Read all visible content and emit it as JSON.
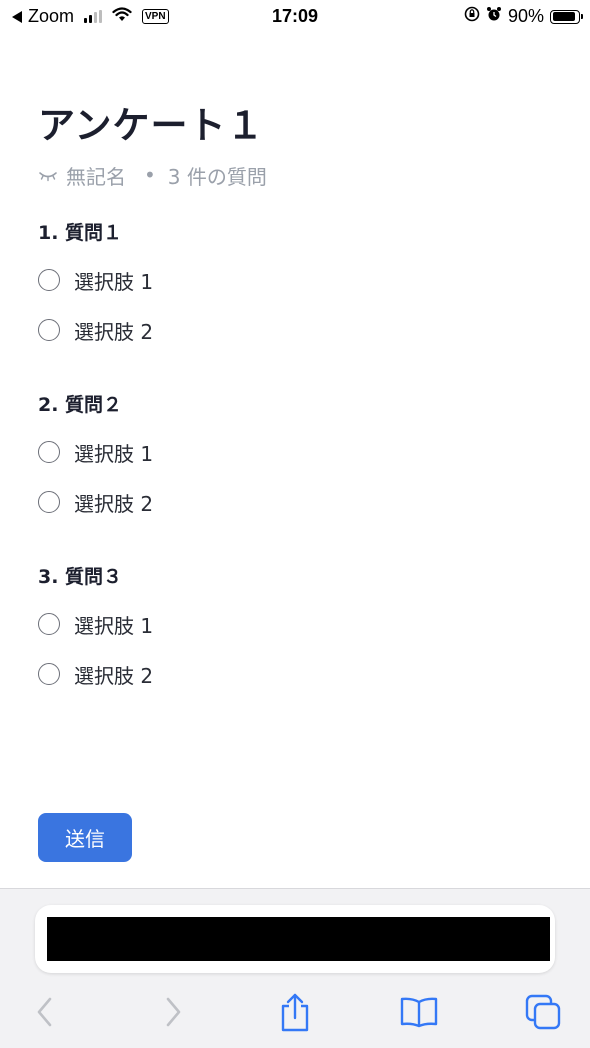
{
  "status_bar": {
    "back_app": "Zoom",
    "vpn": "VPN",
    "time": "17:09",
    "battery": "90%",
    "battery_level": 0.9
  },
  "survey": {
    "title": "アンケート１",
    "anonymous": "無記名",
    "meta_separator": "•",
    "question_count": "3 件の質問",
    "questions": [
      {
        "title": "1. 質問１",
        "options": [
          "選択肢 1",
          "選択肢 2"
        ]
      },
      {
        "title": "2. 質問２",
        "options": [
          "選択肢 1",
          "選択肢 2"
        ]
      },
      {
        "title": "3. 質問３",
        "options": [
          "選択肢 1",
          "選択肢 2"
        ]
      }
    ],
    "submit_label": "送信"
  },
  "colors": {
    "accent": "#3a75e0",
    "title_text": "#1c1f2e",
    "meta_text": "#9aa0aa",
    "safari_icon": "#3478f6",
    "safari_icon_disabled": "#bfc1c6"
  },
  "safari_toolbar": {
    "icons": [
      "back-icon",
      "forward-icon",
      "share-icon",
      "bookmarks-icon",
      "tabs-icon"
    ]
  }
}
